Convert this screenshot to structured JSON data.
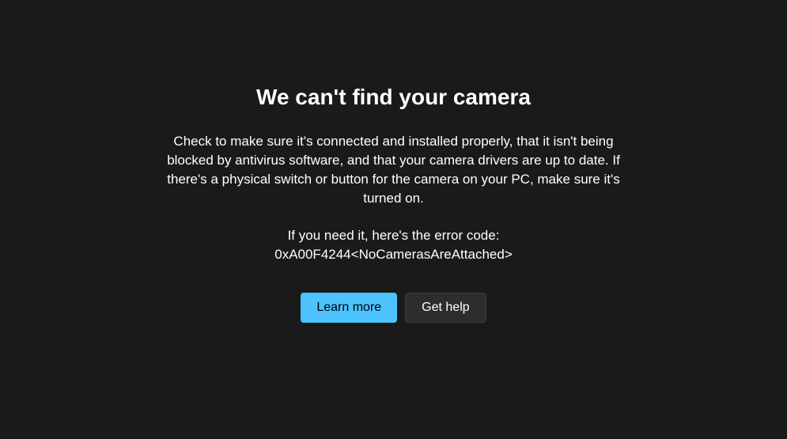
{
  "error": {
    "title": "We can't find your camera",
    "description": "Check to make sure it's connected and installed properly, that it isn't being blocked by antivirus software, and that your camera drivers are up to date. If there's a physical switch or button for the camera on your PC, make sure it's turned on.",
    "code_intro": "If you need it, here's the error code:",
    "code": "0xA00F4244<NoCamerasAreAttached>"
  },
  "buttons": {
    "learn_more": "Learn more",
    "get_help": "Get help"
  },
  "colors": {
    "background": "#1a1a1a",
    "text": "#ffffff",
    "accent": "#4cc2ff",
    "secondary_button": "#2d2d2d"
  }
}
